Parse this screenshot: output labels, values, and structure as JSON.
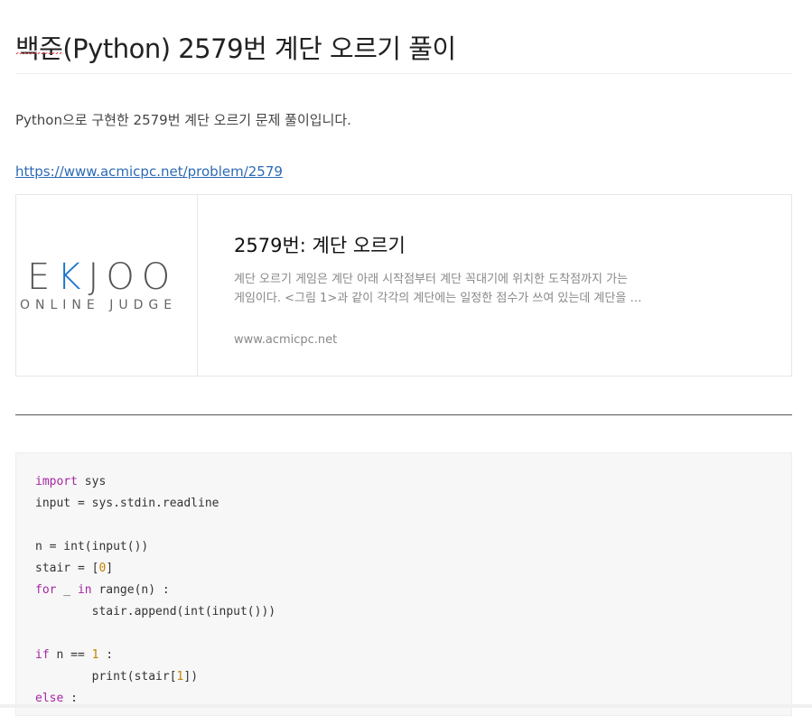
{
  "post": {
    "title": "백준(Python) 2579번 계단 오르기 풀이",
    "intro": "Python으로 구현한 2579번 계단 오르기 문제 풀이입니다.",
    "link": "https://www.acmicpc.net/problem/2579"
  },
  "card": {
    "logo_main_left": "E",
    "logo_main_k": "K",
    "logo_main_right": "JOO",
    "logo_sub": "ONLINE JUDGE",
    "title": "2579번: 계단 오르기",
    "desc_line1": "계단 오르기 게임은 계단 아래 시작점부터 계단 꼭대기에 위치한 도착점까지 가는",
    "desc_line2": "게임이다. <그림 1>과 같이 각각의 계단에는 일정한 점수가 쓰여 있는데 계단을 …",
    "domain": "www.acmicpc.net"
  },
  "code": {
    "l1_kw": "import",
    "l1_rest": " sys",
    "l2": "input = sys.stdin.readline",
    "l4": "n = int(input())",
    "l5_a": "stair = [",
    "l5_num": "0",
    "l5_b": "]",
    "l6_kw1": "for",
    "l6_mid": " _ ",
    "l6_kw2": "in",
    "l6_rest": " range(n) :",
    "l7": "        stair.append(int(input()))",
    "l9_kw": "if",
    "l9_mid": " n == ",
    "l9_num": "1",
    "l9_rest": " :",
    "l10_a": "        print(stair[",
    "l10_num": "1",
    "l10_b": "])",
    "l11_kw": "else",
    "l11_rest": " :"
  },
  "colors": {
    "link": "#2d6ab4",
    "keyword": "#a626a4",
    "number": "#c18401",
    "logo_accent": "#1a73c8"
  }
}
